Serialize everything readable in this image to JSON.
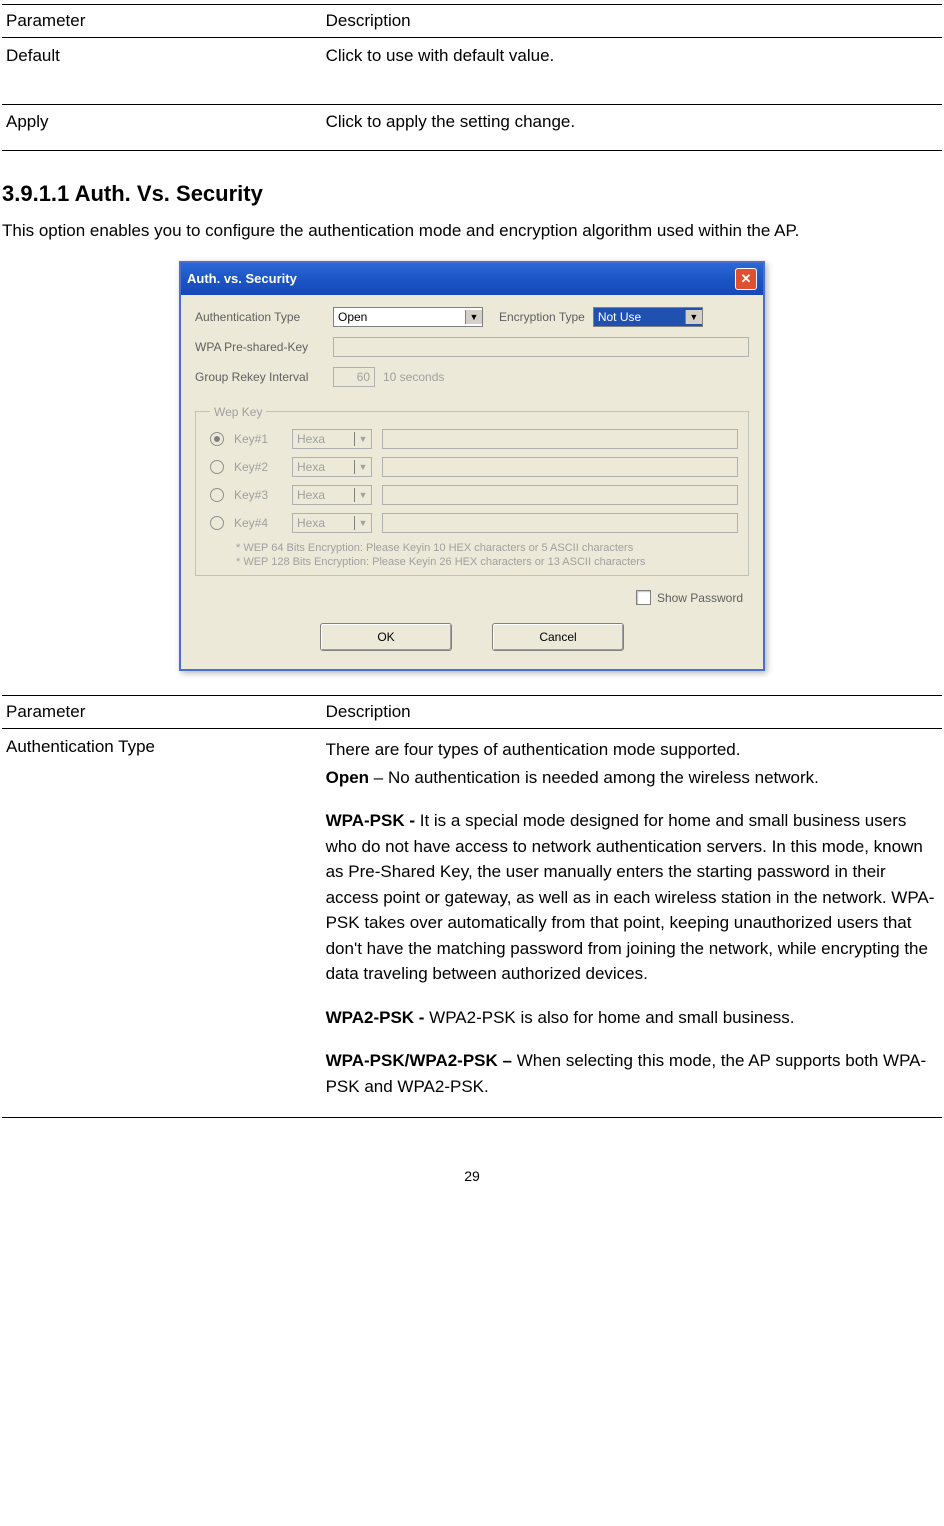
{
  "table1": {
    "header": {
      "c1": "Parameter",
      "c2": "Description"
    },
    "rows": [
      {
        "c1": "Default",
        "c2": "Click to use with default value."
      },
      {
        "c1": "Apply",
        "c2": "Click to apply the setting change."
      }
    ]
  },
  "section": {
    "heading": "3.9.1.1 Auth. Vs. Security",
    "intro": "This option enables you to configure the authentication mode and encryption algorithm used within the AP."
  },
  "dialog": {
    "title": "Auth. vs. Security",
    "labels": {
      "authType": "Authentication Type",
      "encType": "Encryption Type",
      "psk": "WPA Pre-shared-Key",
      "gri": "Group Rekey Interval",
      "griUnit": "10 seconds"
    },
    "values": {
      "authType": "Open",
      "encType": "Not Use",
      "psk": "",
      "gri": "60"
    },
    "wep": {
      "legend": "Wep Key",
      "rows": [
        {
          "label": "Key#1",
          "format": "Hexa",
          "selected": true
        },
        {
          "label": "Key#2",
          "format": "Hexa",
          "selected": false
        },
        {
          "label": "Key#3",
          "format": "Hexa",
          "selected": false
        },
        {
          "label": "Key#4",
          "format": "Hexa",
          "selected": false
        }
      ],
      "note1": "* WEP 64 Bits Encryption:  Please Keyin 10 HEX characters or 5 ASCII characters",
      "note2": "* WEP 128 Bits Encryption:  Please Keyin 26 HEX characters or 13 ASCII characters"
    },
    "showPassword": "Show Password",
    "buttons": {
      "ok": "OK",
      "cancel": "Cancel"
    }
  },
  "table2": {
    "header": {
      "c1": "Parameter",
      "c2": "Description"
    },
    "row": {
      "c1": "Authentication Type",
      "p1": "There are four types of authentication mode supported.",
      "open_b": "Open",
      "open_t": " – No authentication is needed among the wireless network.",
      "wpa_b": "WPA-PSK - ",
      "wpa_t": "It is a special mode designed for home and small business users who do not have access to network authentication servers. In this mode, known as Pre-Shared Key, the user manually enters the starting password in their access point or gateway, as well as in each wireless station in the network. WPA-PSK takes over automatically from that point, keeping unauthorized users that don't have the matching password from joining the network, while encrypting the data traveling between authorized devices.",
      "wpa2_b": "WPA2-PSK - ",
      "wpa2_t": "WPA2-PSK is also for home and small business.",
      "both_b": "WPA-PSK/WPA2-PSK – ",
      "both_t": "When selecting this mode, the AP supports both WPA-PSK and WPA2-PSK."
    }
  },
  "pagenum": "29"
}
